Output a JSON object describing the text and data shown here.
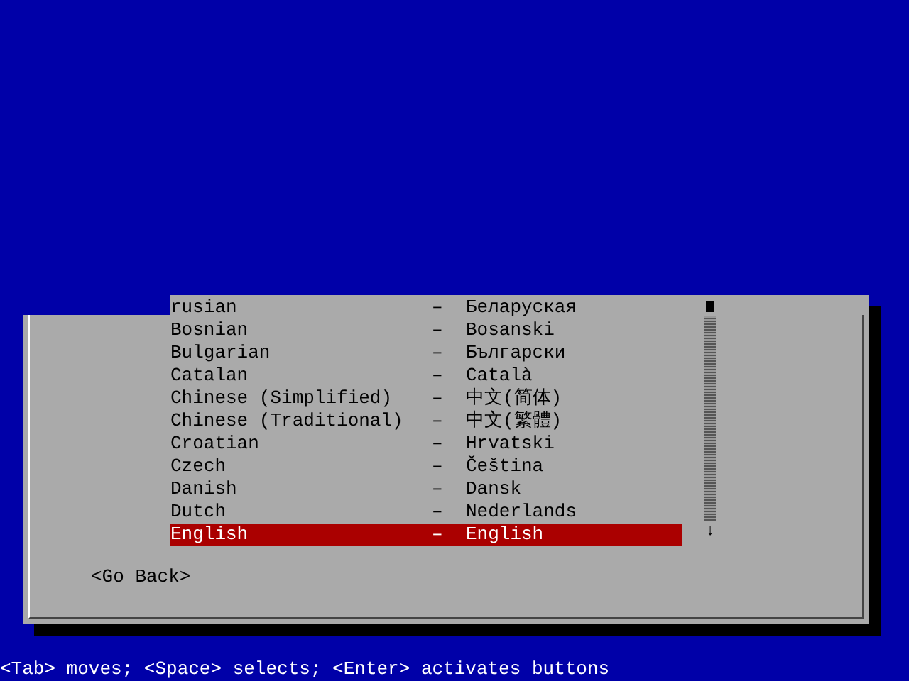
{
  "list": {
    "items": [
      {
        "name": "rusian",
        "native": "Беларуская",
        "selected": false
      },
      {
        "name": "Bosnian",
        "native": "Bosanski",
        "selected": false
      },
      {
        "name": "Bulgarian",
        "native": "Български",
        "selected": false
      },
      {
        "name": "Catalan",
        "native": "Català",
        "selected": false
      },
      {
        "name": "Chinese (Simplified)",
        "native": "中文(简体)",
        "selected": false
      },
      {
        "name": "Chinese (Traditional)",
        "native": "中文(繁體)",
        "selected": false
      },
      {
        "name": "Croatian",
        "native": "Hrvatski",
        "selected": false
      },
      {
        "name": "Czech",
        "native": "Čeština",
        "selected": false
      },
      {
        "name": "Danish",
        "native": "Dansk",
        "selected": false
      },
      {
        "name": "Dutch",
        "native": "Nederlands",
        "selected": false
      },
      {
        "name": "English",
        "native": "English",
        "selected": true
      }
    ],
    "separator": "–",
    "scroll_arrow": "↓"
  },
  "go_back": "<Go Back>",
  "status_bar": "<Tab> moves; <Space> selects; <Enter> activates buttons"
}
